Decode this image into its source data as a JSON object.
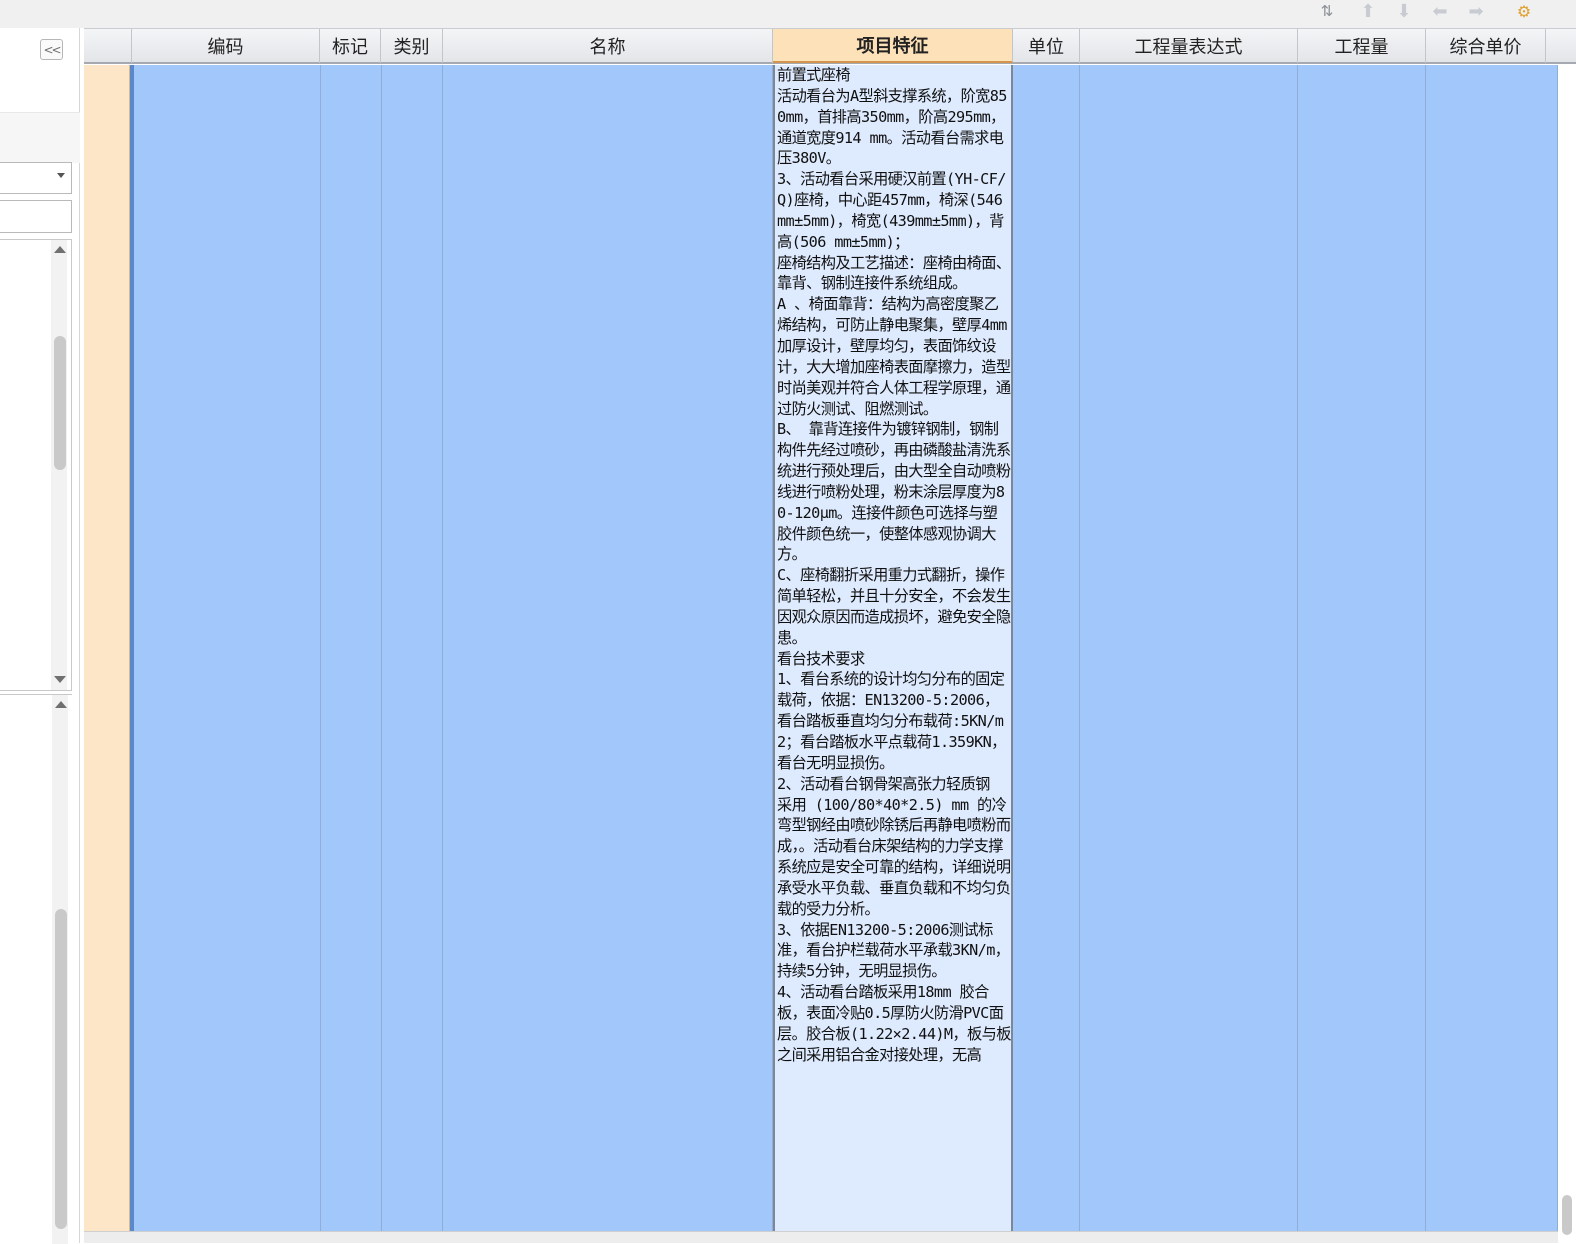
{
  "toolbar": {
    "icons": [
      "sort-icon",
      "move-up-icon",
      "move-down-icon",
      "arrow-left-icon",
      "arrow-right-icon",
      "settings-icon"
    ]
  },
  "left_panel": {
    "collapse_label": "<<"
  },
  "grid": {
    "columns": [
      "编码",
      "标记",
      "类别",
      "名称",
      "项目特征",
      "单位",
      "工程量表达式",
      "工程量",
      "综合单价"
    ],
    "active_column": "项目特征",
    "row": {
      "code": "",
      "mark": "",
      "category": "",
      "name": "",
      "feature": "前置式座椅\n活动看台为A型斜支撑系统，阶宽850mm，首排高350mm，阶高295mm，通道宽度914 mm。活动看台需求电压380V。\n3、活动看台采用硬汉前置(YH-CF/Q)座椅，中心距457mm，椅深(546 mm±5mm)，椅宽(439mm±5mm)，背高(506 mm±5mm)；\n座椅结构及工艺描述：座椅由椅面、靠背、钢制连接件系统组成。\nA 、椅面靠背：结构为高密度聚乙烯结构，可防止静电聚集，壁厚4mm加厚设计，壁厚均匀，表面饰纹设计，大大增加座椅表面摩擦力，造型时尚美观并符合人体工程学原理，通过防火测试、阻燃测试。\nB、 靠背连接件为镀锌钢制，钢制构件先经过喷砂，再由磷酸盐清洗系统进行预处理后，由大型全自动喷粉线进行喷粉处理，粉末涂层厚度为80-120μm。连接件颜色可选择与塑胶件颜色统一，使整体感观协调大方。\nC、座椅翻折采用重力式翻折，操作简单轻松，并且十分安全，不会发生因观众原因而造成损坏，避免安全隐患。\n看台技术要求\n1、看台系统的设计均匀分布的固定载荷，依据：EN13200-5:2006，看台踏板垂直均匀分布载荷:5KN/m2；看台踏板水平点载荷1.359KN，看台无明显损伤。\n2、活动看台钢骨架高张力轻质钢 采用 (100/80*40*2.5) mm 的冷弯型钢经由喷砂除锈后再静电喷粉而成，。活动看台床架结构的力学支撑系统应是安全可靠的结构，详细说明承受水平负载、垂直负载和不均匀负载的受力分析。\n3、依据EN13200-5:2006测试标准，看台护栏载荷水平承载3KN/m，持续5分钟，无明显损伤。\n4、活动看台踏板采用18mm 胶合板，表面冷贴0.5厚防火防滑PVC面层。胶合板(1.22×2.44)M，板与板之间采用铝合金对接处理，无高",
      "unit": "",
      "expression": "",
      "quantity": "",
      "unit_price": ""
    }
  },
  "colors": {
    "selection": "#a2c8fb",
    "active_cell": "#deeafe",
    "active_header": "#fde1b9",
    "row_header": "#fde5c8"
  }
}
